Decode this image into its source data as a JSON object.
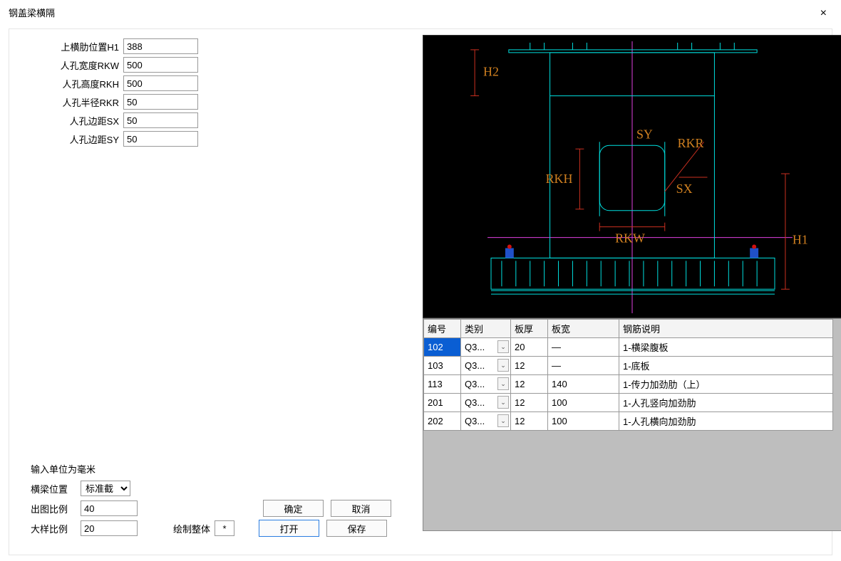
{
  "window": {
    "title": "钢盖梁横隔",
    "close": "×"
  },
  "params": {
    "h1": {
      "label": "上横肋位置H1",
      "value": "388"
    },
    "rkw": {
      "label": "人孔宽度RKW",
      "value": "500"
    },
    "rkh": {
      "label": "人孔高度RKH",
      "value": "500"
    },
    "rkr": {
      "label": "人孔半径RKR",
      "value": "50"
    },
    "sx": {
      "label": "人孔边距SX",
      "value": "50"
    },
    "sy": {
      "label": "人孔边距SY",
      "value": "50"
    }
  },
  "diagram_labels": {
    "h2": "H2",
    "sy": "SY",
    "rkr": "RKR",
    "rkh": "RKH",
    "sx": "SX",
    "rkw": "RKW",
    "h1": "H1"
  },
  "table": {
    "headers": {
      "id": "编号",
      "cat": "类别",
      "thk": "板厚",
      "wid": "板宽",
      "desc": "钢筋说明"
    },
    "rows": [
      {
        "id": "102",
        "cat": "Q3...",
        "thk": "20",
        "wid": "—",
        "desc": "1-横梁腹板",
        "selected": true
      },
      {
        "id": "103",
        "cat": "Q3...",
        "thk": "12",
        "wid": "—",
        "desc": "1-底板"
      },
      {
        "id": "113",
        "cat": "Q3...",
        "thk": "12",
        "wid": "140",
        "desc": "1-传力加劲肋（上）"
      },
      {
        "id": "201",
        "cat": "Q3...",
        "thk": "12",
        "wid": "100",
        "desc": "1-人孔竖向加劲肋"
      },
      {
        "id": "202",
        "cat": "Q3...",
        "thk": "12",
        "wid": "100",
        "desc": "1-人孔横向加劲肋"
      }
    ]
  },
  "bottom": {
    "unit_note": "输入单位为毫米",
    "beam_pos_label": "横梁位置",
    "beam_pos_value": "标准截",
    "out_scale_label": "出图比例",
    "out_scale_value": "40",
    "detail_scale_label": "大样比例",
    "detail_scale_value": "20",
    "draw_whole_label": "绘制整体",
    "draw_whole_value": "*",
    "ok": "确定",
    "cancel": "取消",
    "open": "打开",
    "save": "保存"
  }
}
